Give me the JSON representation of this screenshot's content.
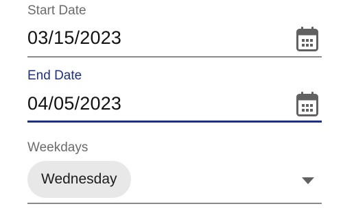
{
  "start_date": {
    "label": "Start Date",
    "value": "03/15/2023",
    "icon": "calendar-icon"
  },
  "end_date": {
    "label": "End Date",
    "value": "04/05/2023",
    "icon": "calendar-icon",
    "focused": true
  },
  "weekdays": {
    "label": "Weekdays",
    "selected": [
      "Wednesday"
    ],
    "icon": "chevron-down-icon"
  },
  "colors": {
    "accent": "#1a2f8a",
    "label": "#6b6b6b",
    "chip_bg": "#e8e8e8",
    "icon": "#616161"
  }
}
